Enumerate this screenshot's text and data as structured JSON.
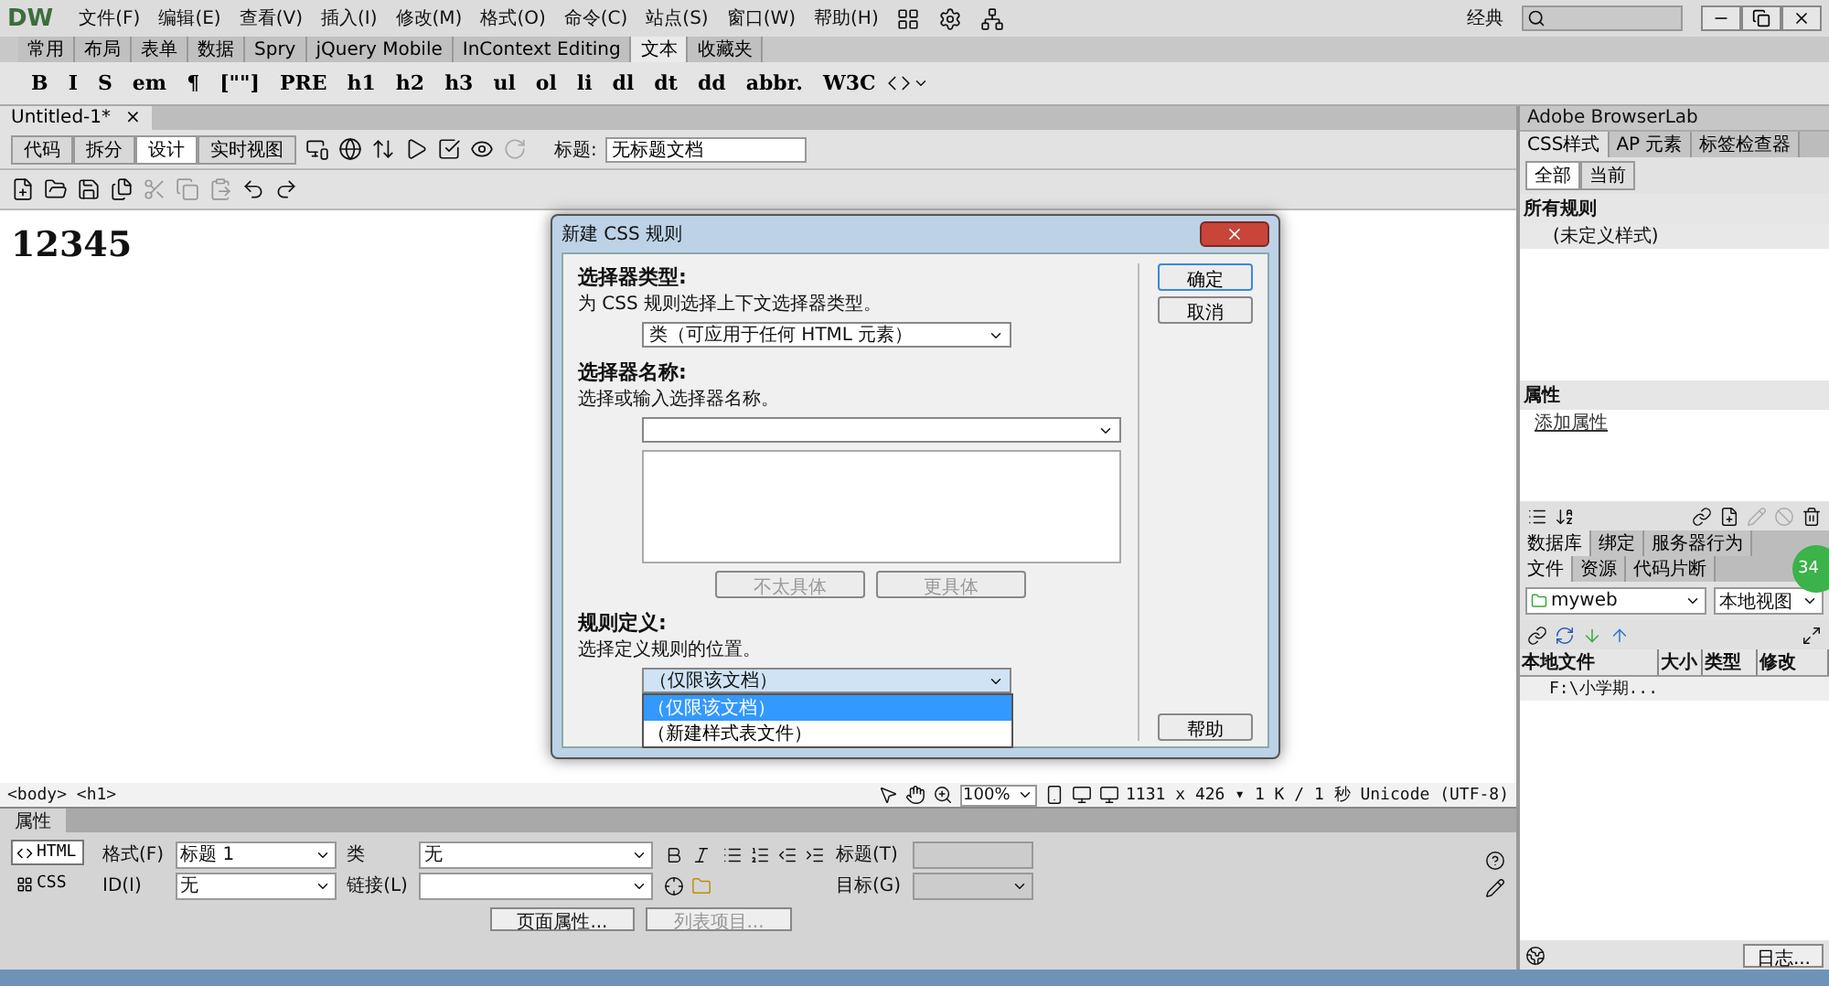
{
  "menubar": {
    "logo": "DW",
    "items": [
      "文件(F)",
      "编辑(E)",
      "查看(V)",
      "插入(I)",
      "修改(M)",
      "格式(O)",
      "命令(C)",
      "站点(S)",
      "窗口(W)",
      "帮助(H)"
    ],
    "workspace": "经典"
  },
  "insert_bar": {
    "tabs": [
      {
        "label": "常用",
        "selected": false
      },
      {
        "label": "布局",
        "selected": false
      },
      {
        "label": "表单",
        "selected": false
      },
      {
        "label": "数据",
        "selected": false
      },
      {
        "label": "Spry",
        "selected": false
      },
      {
        "label": "jQuery Mobile",
        "selected": false
      },
      {
        "label": "InContext Editing",
        "selected": false
      },
      {
        "label": "文本",
        "selected": true
      },
      {
        "label": "收藏夹",
        "selected": false
      }
    ],
    "buttons": [
      "B",
      "I",
      "S",
      "em",
      "¶",
      "[\"\"]",
      "PRE",
      "h1",
      "h2",
      "h3",
      "ul",
      "ol",
      "li",
      "dl",
      "dt",
      "dd",
      "abbr.",
      "W3C"
    ]
  },
  "document": {
    "tab": "Untitled-1*",
    "close": "×",
    "views": [
      {
        "label": "代码",
        "selected": false
      },
      {
        "label": "拆分",
        "selected": false
      },
      {
        "label": "设计",
        "selected": true
      },
      {
        "label": "实时视图",
        "selected": false
      }
    ],
    "title_label": "标题:",
    "title_value": "无标题文档",
    "heading": "12345"
  },
  "status_bar": {
    "tags": "<body> <h1>",
    "zoom": "100%",
    "info": "1131 x 426 ▾ 1 K / 1 秒 Unicode (UTF-8)"
  },
  "properties": {
    "tab": "属性",
    "modes": [
      {
        "label": "HTML",
        "selected": true
      },
      {
        "label": "CSS",
        "selected": false
      }
    ],
    "format_label": "格式(F)",
    "format_value": "标题 1",
    "id_label": "ID(I)",
    "id_value": "无",
    "class_label": "类",
    "class_value": "无",
    "link_label": "链接(L)",
    "title_label": "标题(T)",
    "target_label": "目标(G)",
    "buttons": [
      {
        "label": "页面属性...",
        "disabled": false
      },
      {
        "label": "列表项目...",
        "disabled": true
      }
    ]
  },
  "right_panel": {
    "browserlab": "Adobe BrowserLab",
    "css_tabs": [
      {
        "label": "CSS样式",
        "selected": true
      },
      {
        "label": "AP 元素",
        "selected": false
      },
      {
        "label": "标签检查器",
        "selected": false
      }
    ],
    "subtabs": [
      {
        "label": "全部",
        "selected": true
      },
      {
        "label": "当前",
        "selected": false
      }
    ],
    "rules_heading": "所有规则",
    "rules": [
      "(未定义样式)"
    ],
    "props_heading": "属性",
    "add_property": "添加属性",
    "db_tabs": [
      {
        "label": "数据库",
        "selected": true
      },
      {
        "label": "绑定",
        "selected": false
      },
      {
        "label": "服务器行为",
        "selected": false
      }
    ],
    "file_tabs": [
      {
        "label": "文件",
        "selected": true
      },
      {
        "label": "资源",
        "selected": false
      },
      {
        "label": "代码片断",
        "selected": false
      }
    ],
    "site": "myweb",
    "view": "本地视图",
    "columns": [
      "本地文件",
      "大小",
      "类型",
      "修改"
    ],
    "rows": [
      "F:\\小学期..."
    ],
    "log_button": "日志...",
    "badge": "34"
  },
  "dialog": {
    "title": "新建 CSS 规则",
    "sections": [
      {
        "heading": "选择器类型:",
        "description": "为 CSS 规则选择上下文选择器类型。",
        "kind": "select",
        "value": "类（可应用于任何 HTML 元素）"
      },
      {
        "heading": "选择器名称:",
        "description": "选择或输入选择器名称。",
        "kind": "combo"
      },
      {
        "heading": "规则定义:",
        "description": "选择定义规则的位置。",
        "kind": "select",
        "value": "（仅限该文档）",
        "expanded": true,
        "options": [
          {
            "label": "（仅限该文档）",
            "selected": true
          },
          {
            "label": "（新建样式表文件）",
            "selected": false
          }
        ]
      }
    ],
    "specificity_buttons": [
      {
        "label": "不太具体",
        "disabled": true
      },
      {
        "label": "更具体",
        "disabled": true
      }
    ],
    "buttons": [
      "确定",
      "取消",
      "帮助"
    ]
  }
}
